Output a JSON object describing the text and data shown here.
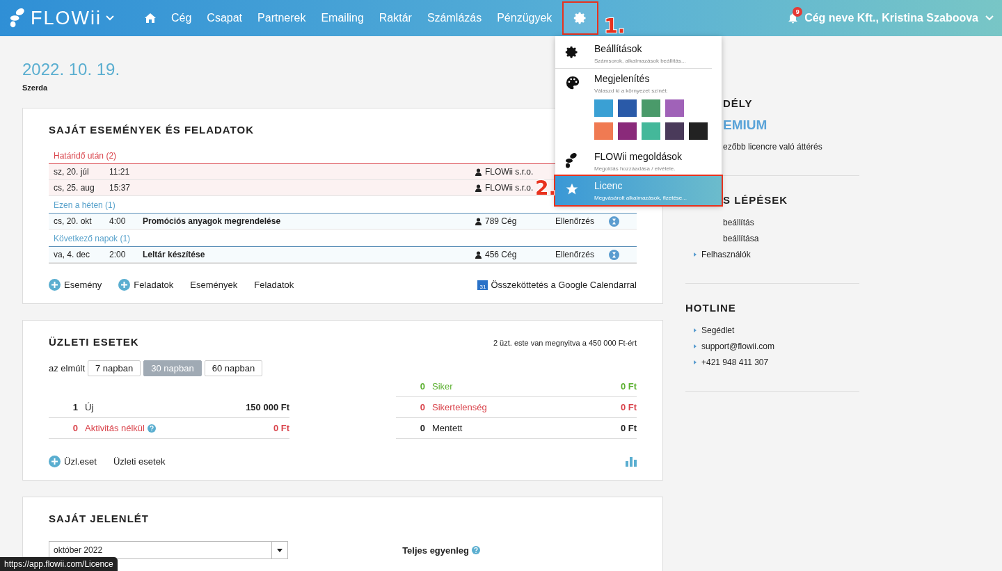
{
  "header": {
    "logo": "FLOWii",
    "nav": [
      {
        "kind": "home",
        "selected": false
      },
      {
        "kind": "text",
        "label": "Cég",
        "selected": false
      },
      {
        "kind": "text",
        "label": "Csapat",
        "selected": false
      },
      {
        "kind": "text",
        "label": "Partnerek",
        "selected": false
      },
      {
        "kind": "text",
        "label": "Emailing",
        "selected": false
      },
      {
        "kind": "text",
        "label": "Raktár",
        "selected": false
      },
      {
        "kind": "text",
        "label": "Számlázás",
        "selected": false
      },
      {
        "kind": "text",
        "label": "Pénzügyek",
        "selected": false
      },
      {
        "kind": "settings",
        "selected": true,
        "step": "1."
      }
    ],
    "notifications": "9",
    "user": "Cég neve Kft., Kristina Szaboova"
  },
  "date": {
    "value": "2022. 10. 19.",
    "weekday": "Szerda"
  },
  "events": {
    "title": "SAJÁT ESEMÉNYEK ÉS FELADATOK",
    "groups": [
      {
        "label": "Határidő után (2)",
        "kind": "overdue",
        "rows": [
          {
            "date": "sz, 20. júl",
            "time": "11:21",
            "title": "",
            "company": "FLOWii s.r.o.",
            "status": ""
          },
          {
            "date": "cs, 25. aug",
            "time": "15:37",
            "title": "",
            "company": "FLOWii s.r.o.",
            "status": ""
          }
        ]
      },
      {
        "label": "Ezen a héten (1)",
        "kind": "week",
        "rows": [
          {
            "date": "cs, 20. okt",
            "time": "4:00",
            "title": "Promóciós anyagok megrendelése",
            "company": "789 Cég",
            "status": "Ellenőrzés"
          }
        ]
      },
      {
        "label": "Következő napok (1)",
        "kind": "upcoming",
        "rows": [
          {
            "date": "va, 4. dec",
            "time": "2:00",
            "title": "Leltár készítése",
            "company": "456 Cég",
            "status": "Ellenőrzés"
          }
        ]
      }
    ],
    "actions": [
      {
        "label": "Esemény",
        "kind": "add"
      },
      {
        "label": "Feladatok",
        "kind": "add"
      },
      {
        "label": "Események",
        "kind": "link"
      },
      {
        "label": "Feladatok",
        "kind": "link"
      }
    ],
    "calendar_link": "Összeköttetés a Google Calendarral",
    "calendar_day": "31"
  },
  "deals": {
    "title": "ÜZLETI ESETEK",
    "summary": "2 üzt. este van megnyitva a 450 000 Ft-ért",
    "period_label": "az elmúlt",
    "periods": [
      {
        "label": "7 napban",
        "selected": false
      },
      {
        "label": "30 napban",
        "selected": true
      },
      {
        "label": "60 napban",
        "selected": false
      }
    ],
    "left": [
      {
        "count": "1",
        "label": "Új",
        "amount": "150 000 Ft",
        "kind": "neutral",
        "help": false
      },
      {
        "count": "0",
        "label": "Aktivitás nélkül",
        "amount": "0 Ft",
        "kind": "danger",
        "help": true
      }
    ],
    "right": [
      {
        "count": "0",
        "label": "Siker",
        "amount": "0 Ft",
        "kind": "success",
        "help": false
      },
      {
        "count": "0",
        "label": "Sikertelenség",
        "amount": "0 Ft",
        "kind": "danger",
        "help": false
      },
      {
        "count": "0",
        "label": "Mentett",
        "amount": "0 Ft",
        "kind": "neutral",
        "help": false
      }
    ],
    "actions": [
      {
        "label": "Üzl.eset",
        "kind": "add"
      },
      {
        "label": "Üzleti esetek",
        "kind": "link"
      }
    ]
  },
  "attendance": {
    "title": "SAJÁT JELENLÉT",
    "month": "október 2022",
    "balance_label": "Teljes egyenleg"
  },
  "sidebar": [
    {
      "title": "DÉLY",
      "kind": "partial",
      "plan": "EMIUM",
      "items": [
        {
          "label": "ezőbb licencre való áttérés",
          "bullet": false
        }
      ]
    },
    {
      "title": "S LÉPÉSEK",
      "kind": "partial",
      "items": [
        {
          "label": "beállítás",
          "bullet": false
        },
        {
          "label": "beállítása",
          "bullet": false
        },
        {
          "label": "Felhasználók",
          "bullet": true
        }
      ]
    },
    {
      "title": "HOTLINE",
      "kind": "full",
      "items": [
        {
          "label": "Segédlet",
          "bullet": true
        },
        {
          "label": "support@flowii.com",
          "bullet": true
        },
        {
          "label": "+421 948 411 307",
          "bullet": true
        }
      ]
    }
  ],
  "settings_menu": {
    "items": [
      {
        "kind": "gear",
        "title": "Beállítások",
        "subtitle": "Számsorok, alkalmazások beállítás...",
        "selected": false
      },
      {
        "kind": "palette",
        "title": "Megjelenítés",
        "subtitle": "Válaszd ki a környezet színét:",
        "selected": false,
        "swatches": [
          {
            "color": "#3aa0d4"
          },
          {
            "color": "#2a5aa8"
          },
          {
            "color": "#4a9a6a"
          },
          {
            "color": "#a062b8"
          },
          {
            "color": "#f07a52"
          },
          {
            "color": "#8a2a7a"
          },
          {
            "color": "#44b89a"
          },
          {
            "color": "#4a3a5a"
          },
          {
            "color": "#222222"
          }
        ]
      },
      {
        "kind": "drops",
        "title": "FLOWii megoldások",
        "subtitle": "Megoldás hozzáadása / elvétele.",
        "selected": false
      },
      {
        "kind": "star",
        "title": "Licenc",
        "subtitle": "Megvásárolt alkalmazások, fizetése...",
        "selected": true,
        "step": "2."
      }
    ]
  },
  "status_url": "https://app.flowii.com/Licence"
}
